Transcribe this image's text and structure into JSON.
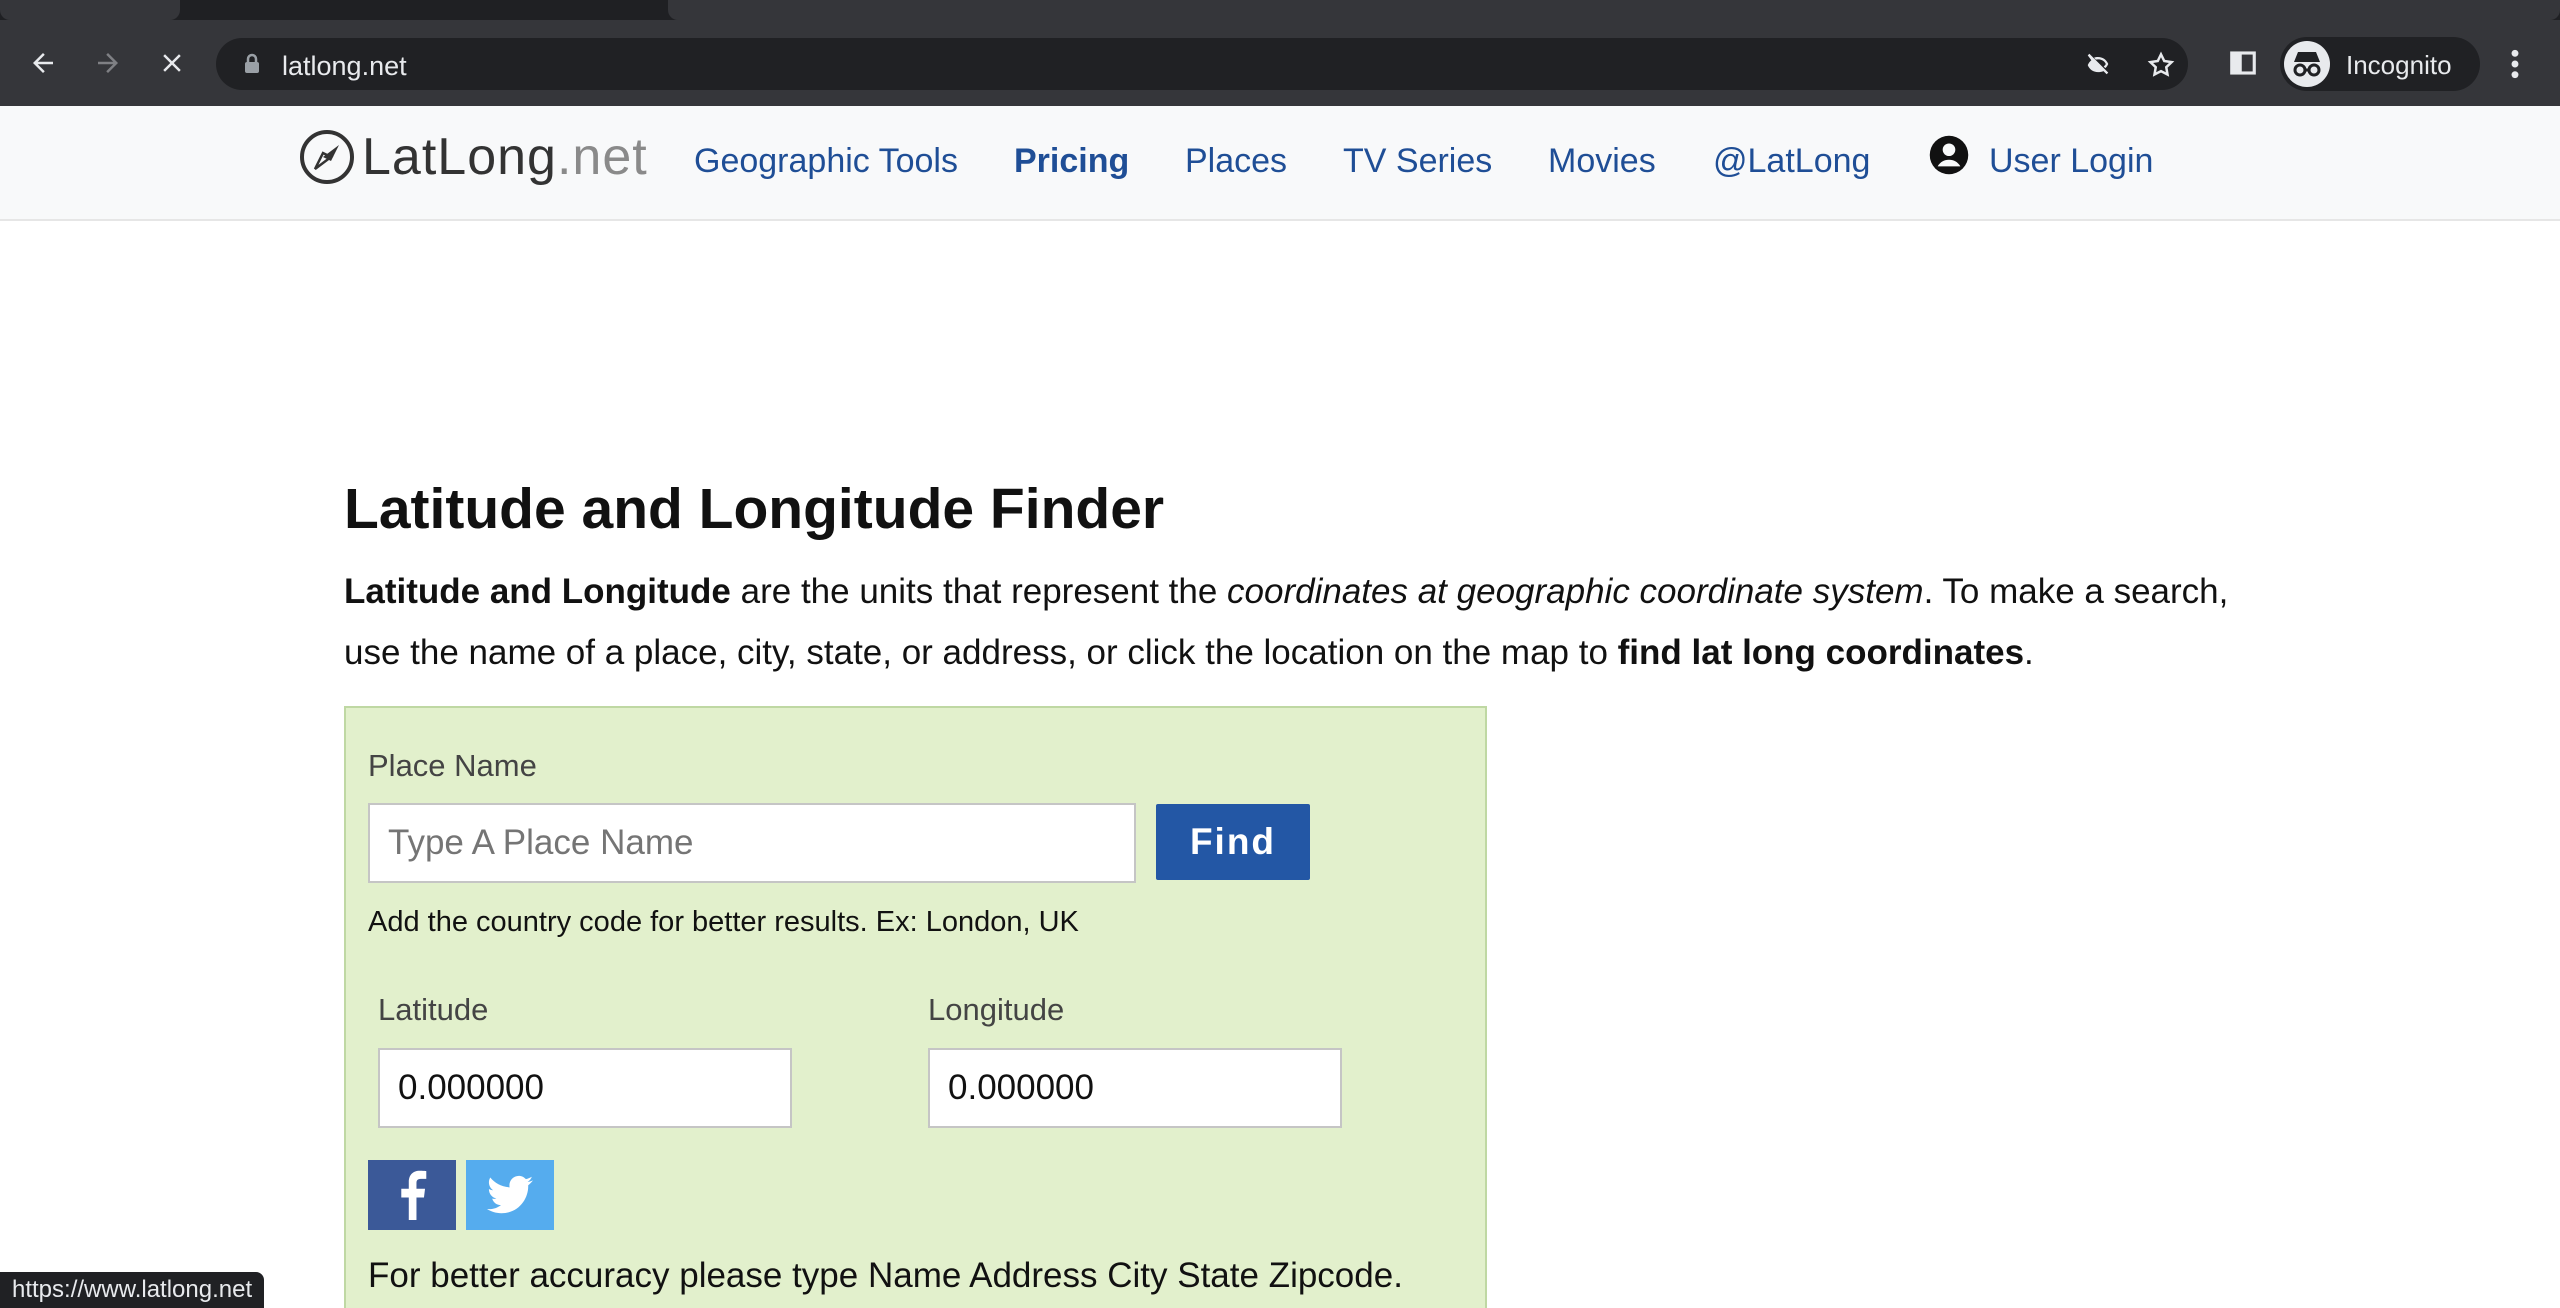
{
  "browser": {
    "url": "latlong.net",
    "incognito_label": "Incognito",
    "status_url": "https://www.latlong.net"
  },
  "site": {
    "logo_main": "LatLong",
    "logo_ext": ".net",
    "nav": {
      "geographic_tools": "Geographic Tools",
      "pricing": "Pricing",
      "places": "Places",
      "tv_series": "TV Series",
      "movies": "Movies",
      "twitter": "@LatLong",
      "user_login": "User Login"
    }
  },
  "main": {
    "title": "Latitude and Longitude Finder",
    "intro": {
      "bold1": "Latitude and Longitude",
      "text1": " are the units that represent the ",
      "italic1": "coordinates at geographic coordinate system",
      "text2": ". To make a search, use the name of a place, city, state, or address, or click the location on the map to ",
      "bold2": "find lat long coordinates",
      "text3": "."
    }
  },
  "finder": {
    "place_label": "Place Name",
    "place_placeholder": "Type A Place Name",
    "find_label": "Find",
    "hint": "Add the country code for better results. Ex: London, UK",
    "latitude_label": "Latitude",
    "latitude_value": "0.000000",
    "longitude_label": "Longitude",
    "longitude_value": "0.000000",
    "accuracy_note": "For better accuracy please type Name Address City State Zipcode."
  },
  "colors": {
    "nav_link": "#1f4e96",
    "find_button": "#2357a5",
    "finder_bg": "#e2f0cc",
    "facebook": "#3b5998",
    "twitter": "#55acee"
  }
}
